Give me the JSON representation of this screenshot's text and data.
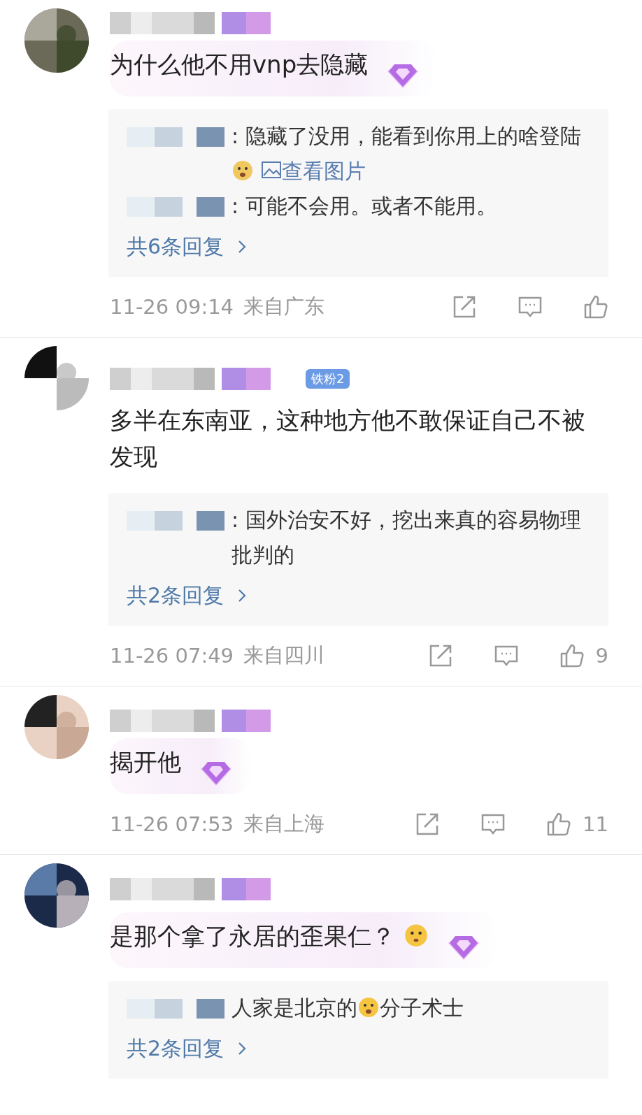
{
  "comments": [
    {
      "bubble": true,
      "text": [
        {
          "kind": "text",
          "text": "为什么他不用vnp去隐藏"
        }
      ],
      "replies": [
        {
          "segments": [
            {
              "kind": "text",
              "text": ": 隐藏了没用，能看到你用上的啥登陆"
            },
            {
              "kind": "doge"
            },
            {
              "kind": "link",
              "text": "查看图片"
            }
          ]
        },
        {
          "segments": [
            {
              "kind": "text",
              "text": ": 可能不会用。或者不能用。"
            }
          ]
        }
      ],
      "more_replies": "共6条回复",
      "time": "11-26 09:14",
      "location": "来自广东"
    },
    {
      "badge": "铁粉2",
      "bubble": false,
      "text": [
        {
          "kind": "text",
          "text": "多半在东南亚，这种地方他不敢保证自己不被发现"
        }
      ],
      "replies": [
        {
          "segments": [
            {
              "kind": "text",
              "text": ": 国外治安不好，挖出来真的容易物理批判的"
            }
          ]
        }
      ],
      "more_replies": "共2条回复",
      "time": "11-26 07:49",
      "location": "来自四川",
      "likes": "9"
    },
    {
      "bubble": true,
      "text": [
        {
          "kind": "text",
          "text": "揭开他"
        }
      ],
      "time": "11-26 07:53",
      "location": "来自上海",
      "likes": "11"
    },
    {
      "bubble": true,
      "text": [
        {
          "kind": "text",
          "text": "是那个拿了永居的歪果仁？"
        },
        {
          "kind": "puzzled"
        }
      ],
      "replies": [
        {
          "segments": [
            {
              "kind": "text",
              "text": "人家是北京的"
            },
            {
              "kind": "cry-laugh"
            },
            {
              "kind": "text",
              "text": "分子术士"
            }
          ]
        }
      ],
      "more_replies": "共2条回复"
    }
  ]
}
